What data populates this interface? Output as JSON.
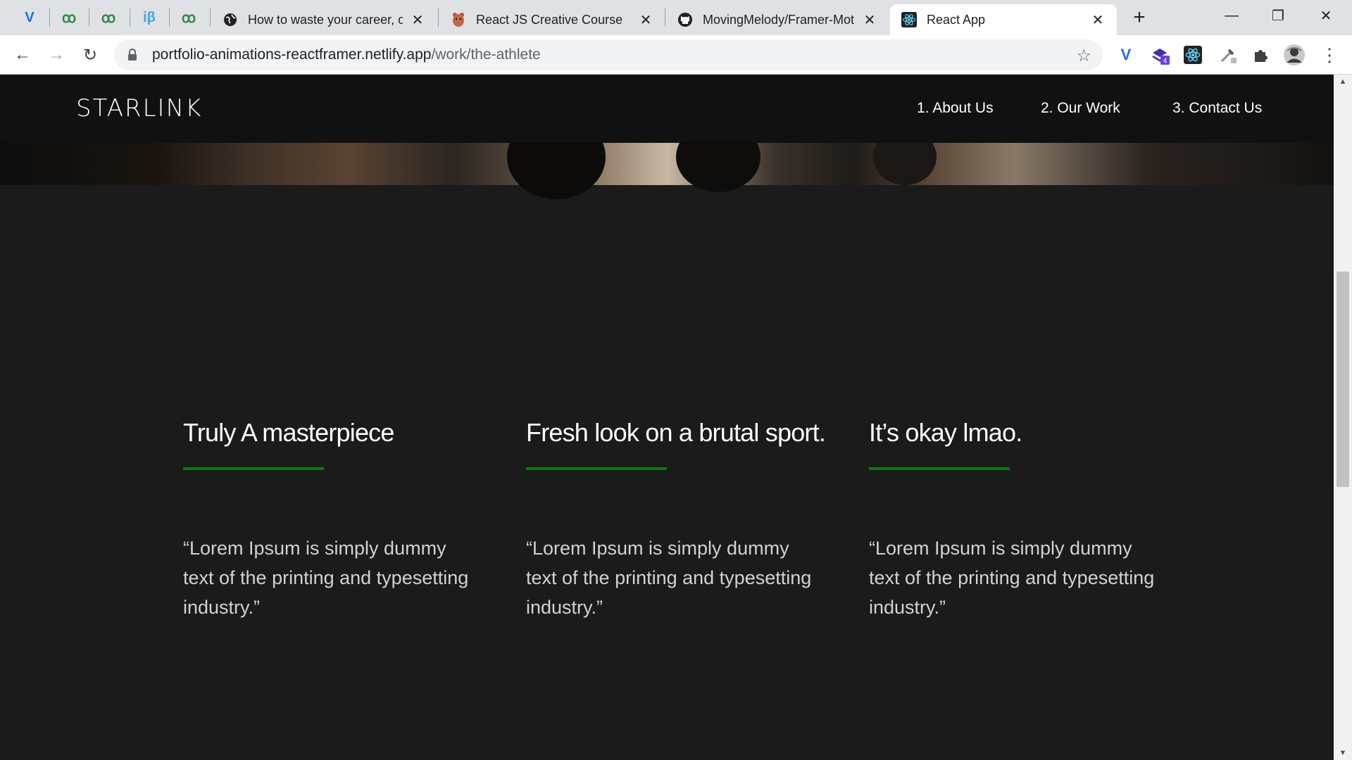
{
  "browser": {
    "pinned_tabs": [
      {
        "icon": "vimeo-icon",
        "glyph": "V",
        "color": "#1e6ee8"
      },
      {
        "icon": "geeks-icon",
        "glyph": "ꝏ",
        "color": "#2f8d46"
      },
      {
        "icon": "geeks-icon",
        "glyph": "ꝏ",
        "color": "#2f8d46"
      },
      {
        "icon": "ib-icon",
        "glyph": "iβ",
        "color": "#3ba7e5"
      },
      {
        "icon": "geeks-icon",
        "glyph": "ꝏ",
        "color": "#2f8d46"
      }
    ],
    "tabs": [
      {
        "title": "How to waste your career, o",
        "icon": "globe-icon"
      },
      {
        "title": "React JS Creative Course",
        "icon": "bear-icon"
      },
      {
        "title": "MovingMelody/Framer-Mot",
        "icon": "github-icon"
      },
      {
        "title": "React App",
        "icon": "react-icon",
        "active": true
      }
    ],
    "url_host": "portfolio-animations-reactframer.netlify.app",
    "url_path": "/work/the-athlete",
    "extension_badge": "4"
  },
  "site": {
    "logo": "STARLINK",
    "nav": [
      "1. About Us",
      "2. Our Work",
      "3. Contact Us"
    ]
  },
  "reviews": [
    {
      "title": "Truly A masterpiece",
      "quote": "“Lorem Ipsum is simply dummy text of the printing and typesetting industry.”"
    },
    {
      "title": "Fresh look on a brutal sport.",
      "quote": "“Lorem Ipsum is simply dummy text of the printing and typesetting industry.”"
    },
    {
      "title": "It’s okay lmao.",
      "quote": "“Lorem Ipsum is simply dummy text of the printing and typesetting industry.”"
    }
  ],
  "colors": {
    "accent_rule": "#0a7a0a",
    "page_bg": "#1b1b1b",
    "header_bg": "#111111"
  }
}
